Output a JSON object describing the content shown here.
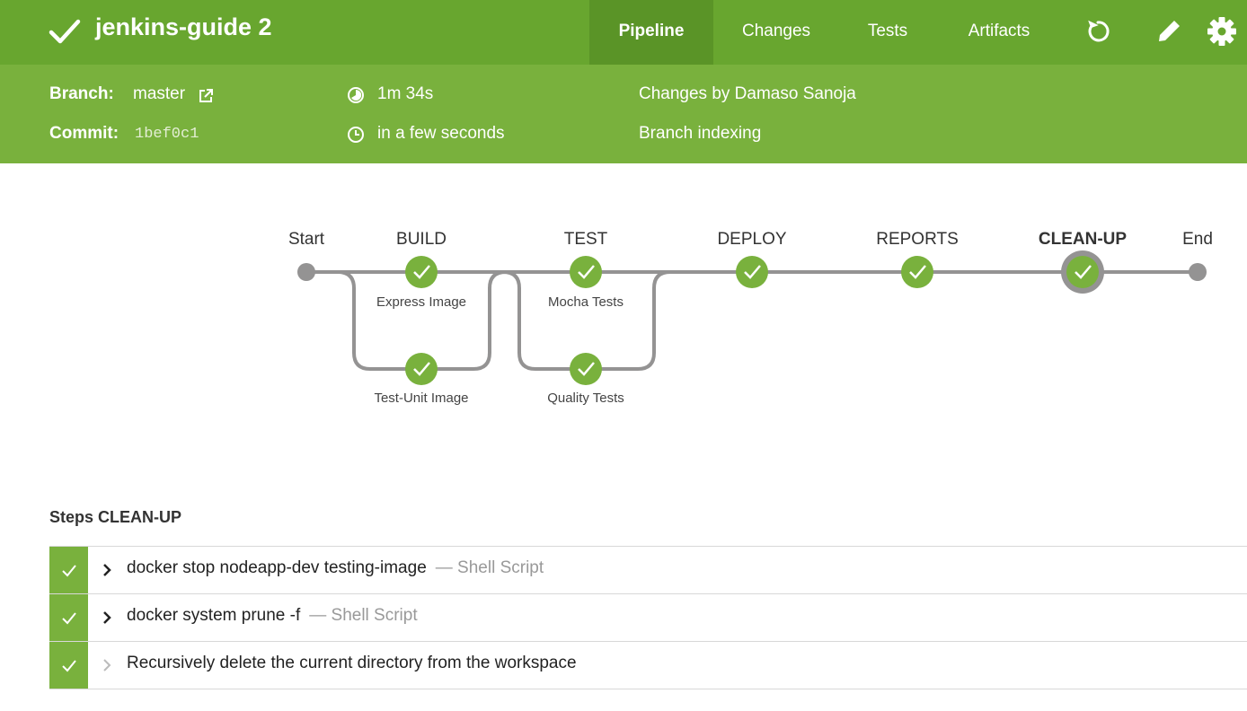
{
  "header": {
    "title": "jenkins-guide 2",
    "tabs": [
      {
        "label": "Pipeline",
        "active": true
      },
      {
        "label": "Changes",
        "active": false
      },
      {
        "label": "Tests",
        "active": false
      },
      {
        "label": "Artifacts",
        "active": false
      }
    ],
    "icons": [
      "check-icon",
      "rerun-icon",
      "edit-icon",
      "settings-icon"
    ]
  },
  "info": {
    "branch_label": "Branch:",
    "branch_value": "master",
    "commit_label": "Commit:",
    "commit_value": "1bef0c1",
    "duration": "1m 34s",
    "started": "in a few seconds",
    "changes": "Changes by Damaso Sanoja",
    "cause": "Branch indexing"
  },
  "pipeline": {
    "start_label": "Start",
    "end_label": "End",
    "stages": [
      {
        "name": "BUILD",
        "branches": [
          "Express Image",
          "Test-Unit Image"
        ],
        "status": "success"
      },
      {
        "name": "TEST",
        "branches": [
          "Mocha Tests",
          "Quality Tests"
        ],
        "status": "success"
      },
      {
        "name": "DEPLOY",
        "branches": [],
        "status": "success"
      },
      {
        "name": "REPORTS",
        "branches": [],
        "status": "success"
      },
      {
        "name": "CLEAN-UP",
        "branches": [],
        "status": "success",
        "selected": true
      }
    ]
  },
  "steps": {
    "title": "Steps CLEAN-UP",
    "items": [
      {
        "command": "docker stop nodeapp-dev testing-image",
        "type": "— Shell Script",
        "expandable": true
      },
      {
        "command": "docker system prune -f",
        "type": "— Shell Script",
        "expandable": true
      },
      {
        "command": "Recursively delete the current directory from the workspace",
        "type": "",
        "expandable": false
      }
    ]
  },
  "colors": {
    "header_bg": "#68a62f",
    "info_bg": "#79b13d",
    "active_tab_bg": "#5a9427",
    "success": "#79b13d",
    "line": "#949393"
  }
}
